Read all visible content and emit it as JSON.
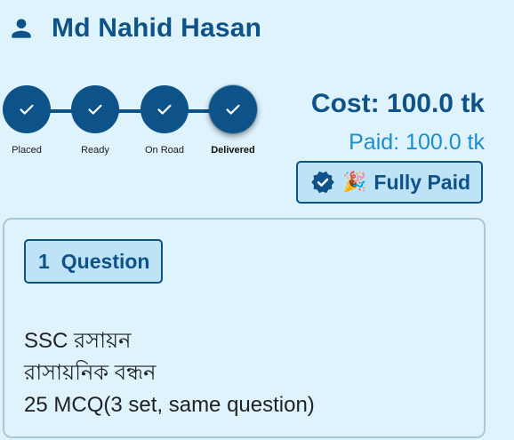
{
  "customer": {
    "name": "Md Nahid Hasan"
  },
  "steps": [
    {
      "label": "Placed",
      "completed": true
    },
    {
      "label": "Ready",
      "completed": true
    },
    {
      "label": "On Road",
      "completed": true
    },
    {
      "label": "Delivered",
      "completed": true,
      "current": true
    }
  ],
  "payment": {
    "cost_text": "Cost: 100.0 tk",
    "paid_text": "Paid: 100.0 tk",
    "status_label": "Fully Paid",
    "status_emoji": "🎉"
  },
  "order": {
    "item_count": "1",
    "item_unit": "Question",
    "lines": [
      "SSC রসায়ন",
      "রাসায়নিক বন্ধন",
      "25 MCQ(3 set, same question)"
    ]
  },
  "colors": {
    "primary": "#0d5289",
    "accent": "#1c8fcb",
    "background": "#dff3fd",
    "badge_fill": "#bfe3f6"
  },
  "icons": {
    "user": "person-icon",
    "step": "check-icon",
    "verified": "verified-badge-icon"
  }
}
